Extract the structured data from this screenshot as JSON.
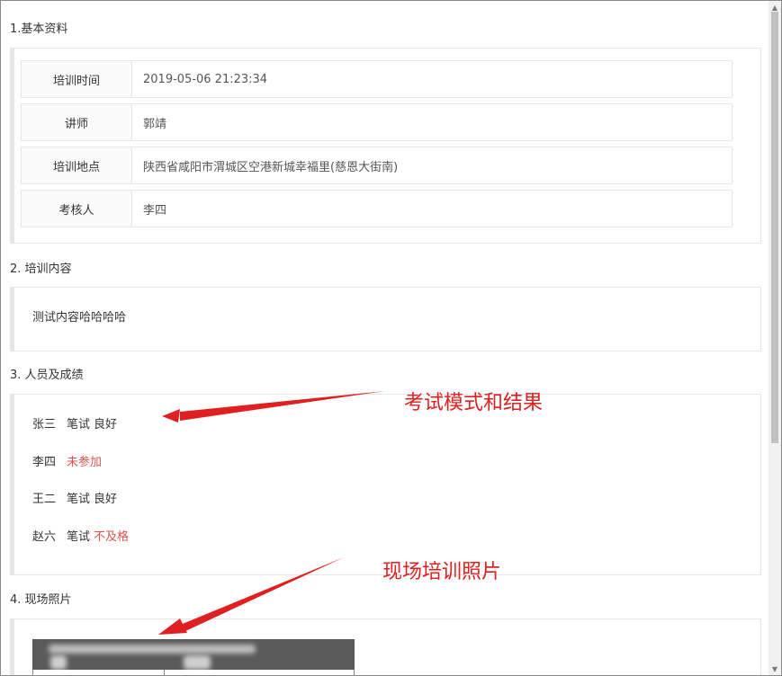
{
  "sections": {
    "basic": {
      "title": "1.基本资料",
      "rows": [
        {
          "label": "培训时间",
          "value": "2019-05-06 21:23:34"
        },
        {
          "label": "讲师",
          "value": "郭靖"
        },
        {
          "label": "培训地点",
          "value": "陕西省咸阳市渭城区空港新城幸福里(慈恩大街南)"
        },
        {
          "label": "考核人",
          "value": "李四"
        }
      ]
    },
    "content": {
      "title": "2. 培训内容",
      "text": "测试内容哈哈哈哈"
    },
    "people": {
      "title": "3. 人员及成绩",
      "items": [
        {
          "name": "张三",
          "mode": "笔试",
          "result": "良好"
        },
        {
          "name": "李四",
          "mode": "",
          "result": "未参加"
        },
        {
          "name": "王二",
          "mode": "笔试",
          "result": "良好"
        },
        {
          "name": "赵六",
          "mode": "笔试",
          "result": "不及格"
        }
      ]
    },
    "photos": {
      "title": "4. 现场照片"
    }
  },
  "annotations": {
    "exam": "考试模式和结果",
    "photo": "现场培训照片"
  },
  "colors": {
    "warning_text": "#e05252",
    "annotation": "#e02020"
  }
}
